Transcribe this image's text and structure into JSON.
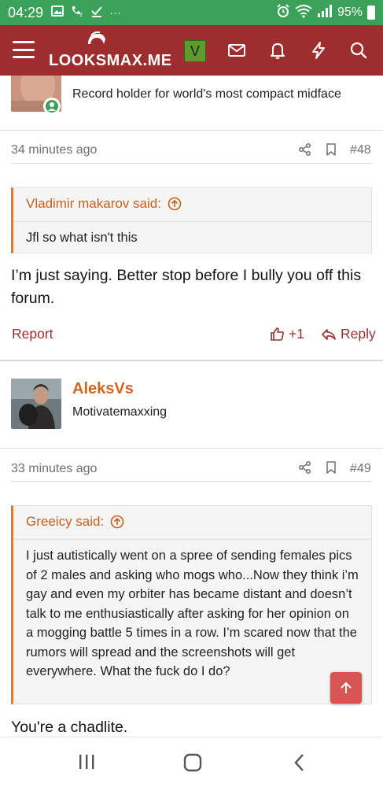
{
  "status_bar": {
    "time": "04:29",
    "battery": "95%",
    "dots": "···"
  },
  "navbar": {
    "logo_text": "LOOKSMAX.ME",
    "avatar_letter": "V",
    "colors": {
      "bar": "#9d2d2f",
      "status": "#3aa05a",
      "accent": "#d4651f",
      "avatar": "#5d9b2f"
    }
  },
  "posts": [
    {
      "id": "post-48",
      "user_title": "Record holder for world's most compact midface",
      "time_ago": "34 minutes ago",
      "post_number": "#48",
      "quote": {
        "author_said": "Vladimir makarov said:",
        "body": "Jfl so what isn't this"
      },
      "message": "I’m just saying. Better stop before I bully you off this forum.",
      "actions": {
        "report": "Report",
        "like_count": "+1",
        "reply": "Reply"
      }
    },
    {
      "id": "post-49",
      "username": "AleksVs",
      "user_title": "Motivatemaxxing",
      "time_ago": "33 minutes ago",
      "post_number": "#49",
      "quote": {
        "author_said": "Greeicy said:",
        "body": "I just autistically went on a spree of sending females pics of 2 males and asking who mogs who...Now they think i’m gay and even my orbiter has became distant and doesn’t talk to me enthusiastically after asking for her opinion on a mogging battle 5 times in a row. I’m scared now that the rumors will spread and the screenshots will get everywhere. What the fuck do I do?"
      },
      "message": "You're a chadlite."
    }
  ]
}
